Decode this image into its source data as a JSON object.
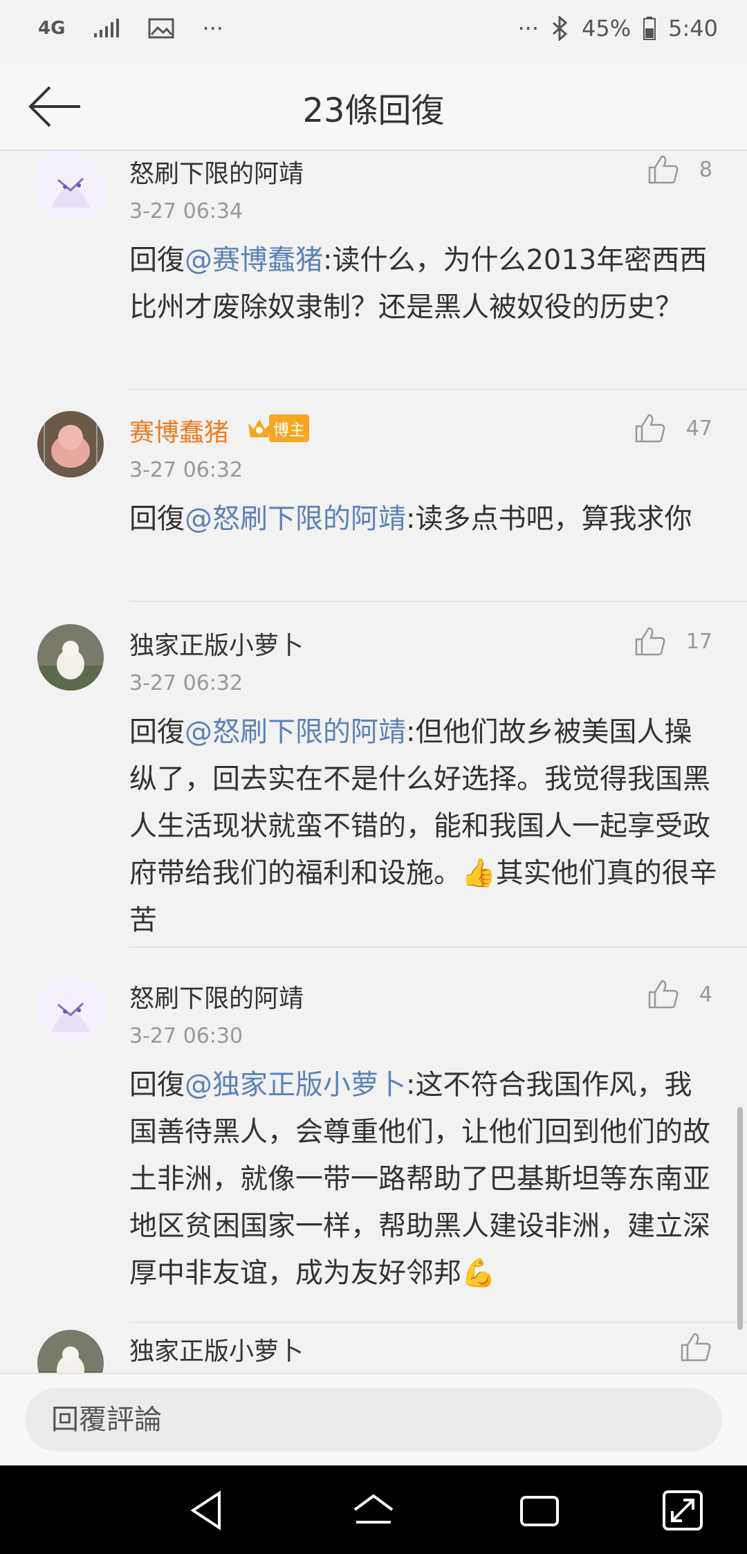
{
  "status_bar": {
    "network": "4G",
    "more": "···",
    "more_right": "···",
    "battery": "45%",
    "time": "5:40"
  },
  "header": {
    "title": "23條回復"
  },
  "comments": [
    {
      "name": "怒刷下限的阿靖",
      "time": "3-27 06:34",
      "likes": "8",
      "reply_prefix": "回復",
      "mention": "@赛博蠢猪",
      "text": ":读什么，为什么2013年密西西比州才废除奴隶制？还是黑人被奴役的历史？"
    },
    {
      "name": "赛博蠢猪",
      "badge": "博主",
      "time": "3-27 06:32",
      "likes": "47",
      "reply_prefix": "回復",
      "mention": "@怒刷下限的阿靖",
      "text": ":读多点书吧，算我求你"
    },
    {
      "name": "独家正版小萝卜",
      "time": "3-27 06:32",
      "likes": "17",
      "reply_prefix": "回復",
      "mention": "@怒刷下限的阿靖",
      "text": ":但他们故乡被美国人操纵了，回去实在不是什么好选择。我觉得我国黑人生活现状就蛮不错的，能和我国人一起享受政府带给我们的福利和设施。👍其实他们真的很辛苦"
    },
    {
      "name": "怒刷下限的阿靖",
      "time": "3-27 06:30",
      "likes": "4",
      "reply_prefix": "回復",
      "mention": "@独家正版小萝卜",
      "text": ":这不符合我国作风，我国善待黑人，会尊重他们，让他们回到他们的故土非洲，就像一带一路帮助了巴基斯坦等东南亚地区贫困国家一样，帮助黑人建设非洲，建立深厚中非友谊，成为友好邻邦💪"
    },
    {
      "name": "独家正版小萝卜"
    }
  ],
  "reply_bar": {
    "placeholder": "回覆評論"
  },
  "icons": {
    "back": "back-arrow-icon",
    "like": "thumbs-up-icon",
    "nav": [
      "back-triangle-icon",
      "home-icon",
      "recents-icon",
      "resize-icon"
    ]
  },
  "colors": {
    "mention": "#5b82b8",
    "blogger_name": "#f07b1f",
    "badge": "#f6a623"
  }
}
